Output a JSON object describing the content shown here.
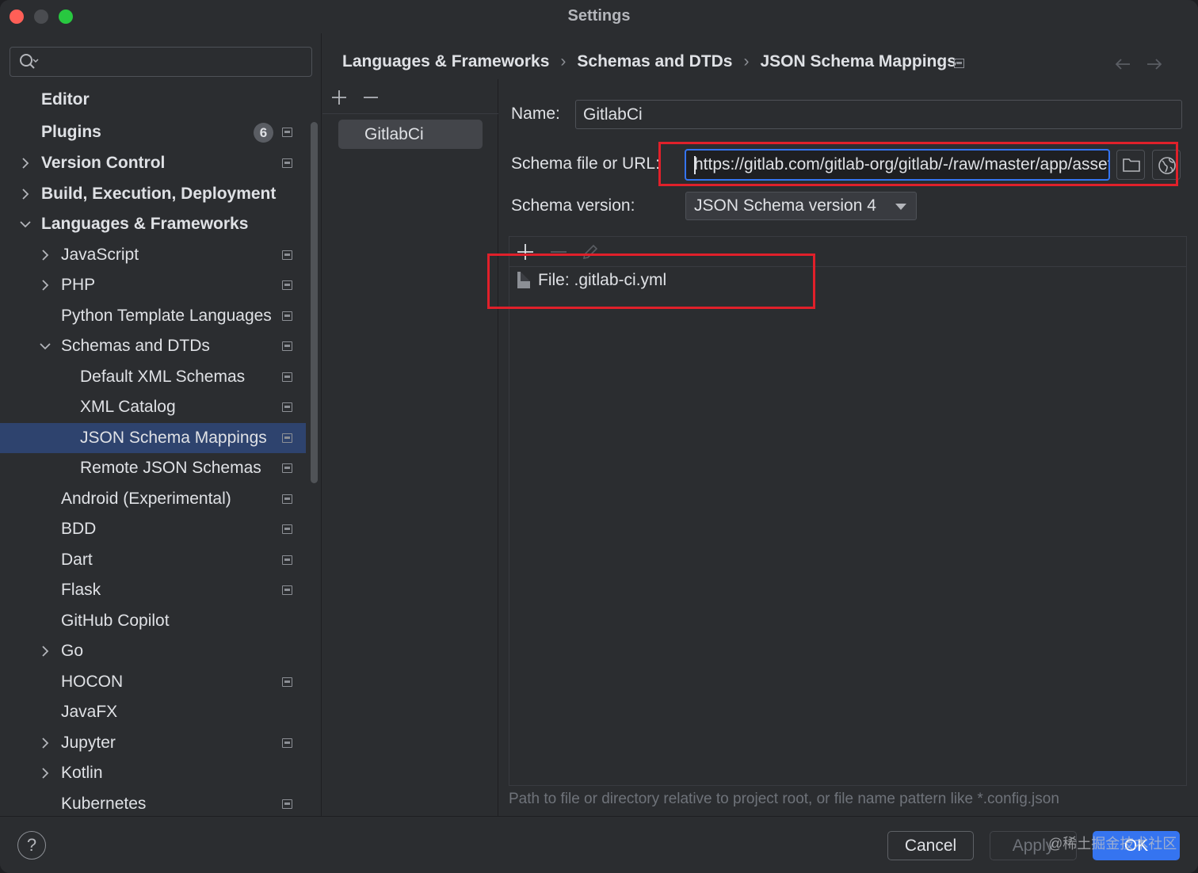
{
  "window": {
    "title": "Settings"
  },
  "search": {
    "placeholder": ""
  },
  "sidebar": {
    "items": [
      {
        "label": "Editor"
      },
      {
        "label": "Plugins",
        "badge": "6"
      },
      {
        "label": "Version Control"
      },
      {
        "label": "Build, Execution, Deployment"
      },
      {
        "label": "Languages & Frameworks"
      },
      {
        "label": "JavaScript"
      },
      {
        "label": "PHP"
      },
      {
        "label": "Python Template Languages"
      },
      {
        "label": "Schemas and DTDs"
      },
      {
        "label": "Default XML Schemas"
      },
      {
        "label": "XML Catalog"
      },
      {
        "label": "JSON Schema Mappings"
      },
      {
        "label": "Remote JSON Schemas"
      },
      {
        "label": "Android (Experimental)"
      },
      {
        "label": "BDD"
      },
      {
        "label": "Dart"
      },
      {
        "label": "Flask"
      },
      {
        "label": "GitHub Copilot"
      },
      {
        "label": "Go"
      },
      {
        "label": "HOCON"
      },
      {
        "label": "JavaFX"
      },
      {
        "label": "Jupyter"
      },
      {
        "label": "Kotlin"
      },
      {
        "label": "Kubernetes"
      }
    ]
  },
  "breadcrumb": {
    "items": [
      "Languages & Frameworks",
      "Schemas and DTDs",
      "JSON Schema Mappings"
    ],
    "separator": "›"
  },
  "mappings_list": {
    "items": [
      "GitlabCi"
    ]
  },
  "form": {
    "name_label": "Name:",
    "name_value": "GitlabCi",
    "schema_label": "Schema file or URL:",
    "schema_value": "https://gitlab.com/gitlab-org/gitlab/-/raw/master/app/assets/javascripts/editor/schema/ci.json",
    "version_label": "Schema version:",
    "version_value": "JSON Schema version 4"
  },
  "file_mappings": {
    "rows": [
      "File: .gitlab-ci.yml"
    ],
    "hint": "Path to file or directory relative to project root, or file name pattern like *.config.json"
  },
  "footer": {
    "help": "?",
    "cancel": "Cancel",
    "apply": "Apply",
    "ok": "OK",
    "watermark": "@稀土掘金技术社区"
  },
  "colors": {
    "accent": "#3574f0",
    "selection": "#2e436e",
    "highlight_box": "#e0202a",
    "background": "#2b2d30"
  },
  "icons": [
    "search-icon",
    "chevron-right-icon",
    "chevron-down-icon",
    "project-settings-icon",
    "add-icon",
    "remove-icon",
    "edit-icon",
    "folder-icon",
    "globe-icon",
    "file-icon",
    "back-arrow-icon",
    "forward-arrow-icon"
  ]
}
